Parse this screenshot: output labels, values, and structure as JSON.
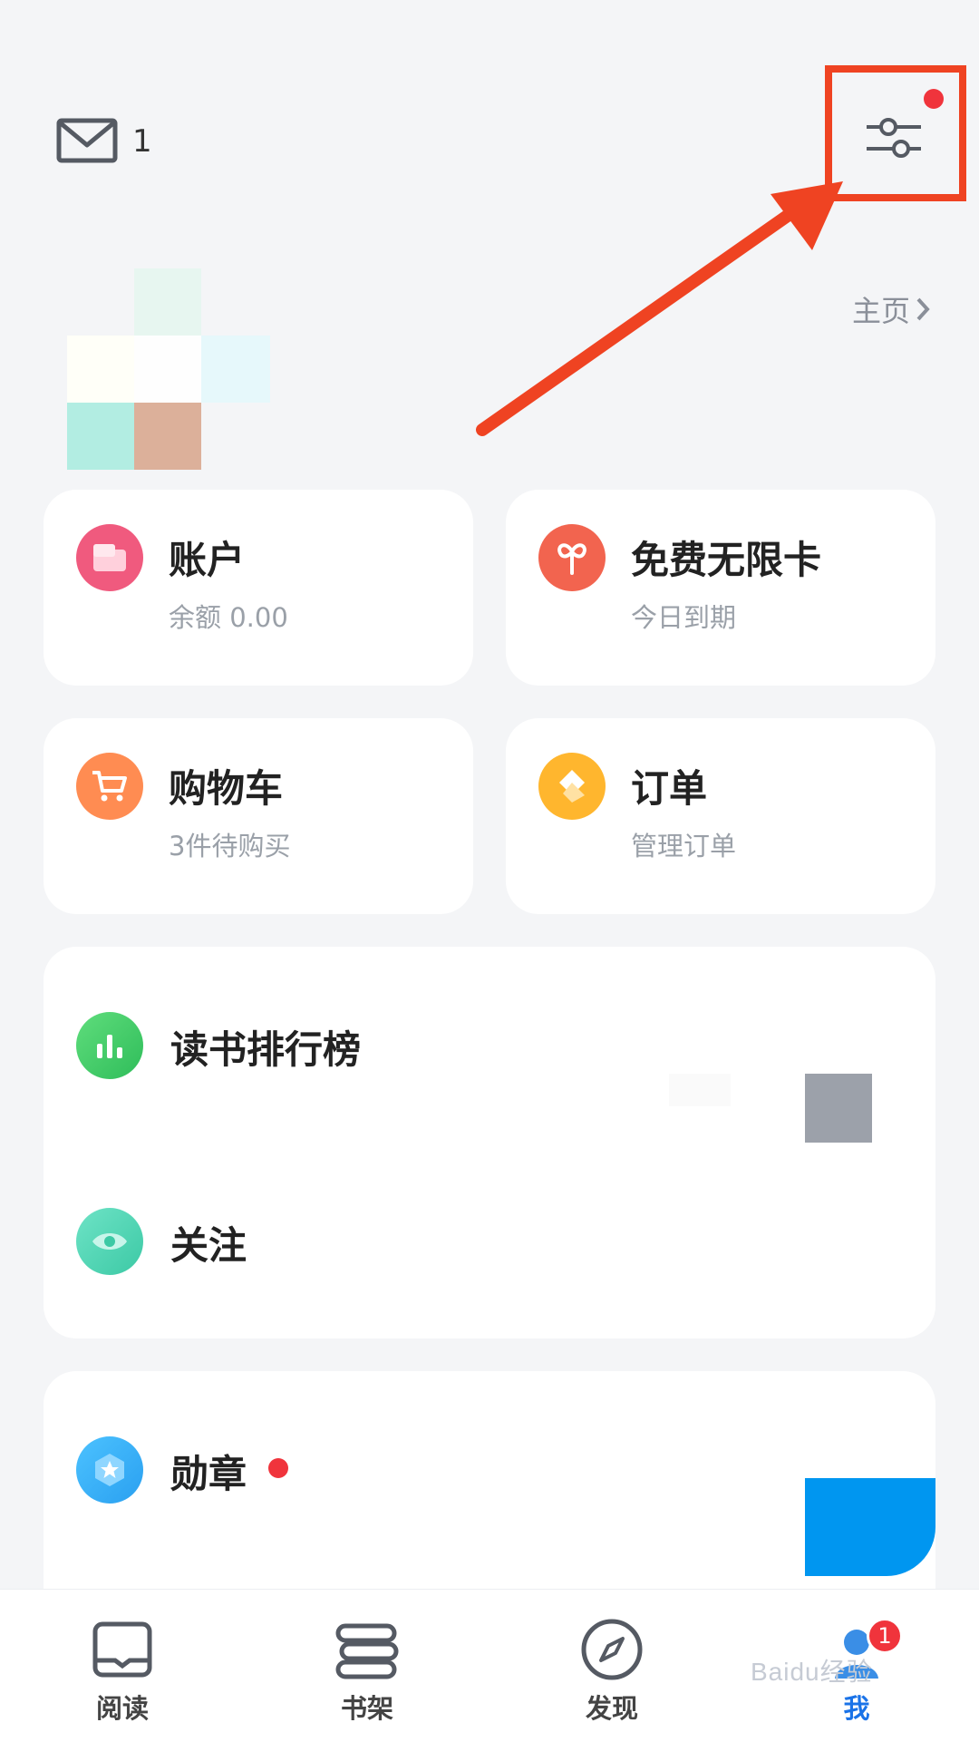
{
  "header": {
    "mail_icon": "envelope-icon",
    "mail_count": "1",
    "settings_icon": "sliders-icon",
    "home_link": "主页"
  },
  "cards": {
    "account": {
      "title": "账户",
      "sub": "余额 0.00",
      "icon": "wallet-icon",
      "color": "#f05a7e"
    },
    "free": {
      "title": "免费无限卡",
      "sub": "今日到期",
      "icon": "infinity-icon",
      "color": "#f2644f"
    },
    "cart": {
      "title": "购物车",
      "sub": "3件待购买",
      "icon": "cart-icon",
      "color": "#ff8c52"
    },
    "order": {
      "title": "订单",
      "sub": "管理订单",
      "icon": "order-icon",
      "color": "#ffb62e"
    }
  },
  "list": {
    "ranking": {
      "title": "读书排行榜",
      "icon": "bar-chart-icon"
    },
    "follow": {
      "title": "关注",
      "icon": "eye-icon"
    },
    "medal": {
      "title": "勋章",
      "icon": "badge-icon"
    }
  },
  "nav": {
    "items": [
      {
        "label": "阅读",
        "icon": "book-icon"
      },
      {
        "label": "书架",
        "icon": "bookshelf-icon"
      },
      {
        "label": "发现",
        "icon": "compass-icon"
      },
      {
        "label": "我",
        "icon": "profile-icon"
      }
    ],
    "badge": "1"
  },
  "watermark": "Baidu经验"
}
